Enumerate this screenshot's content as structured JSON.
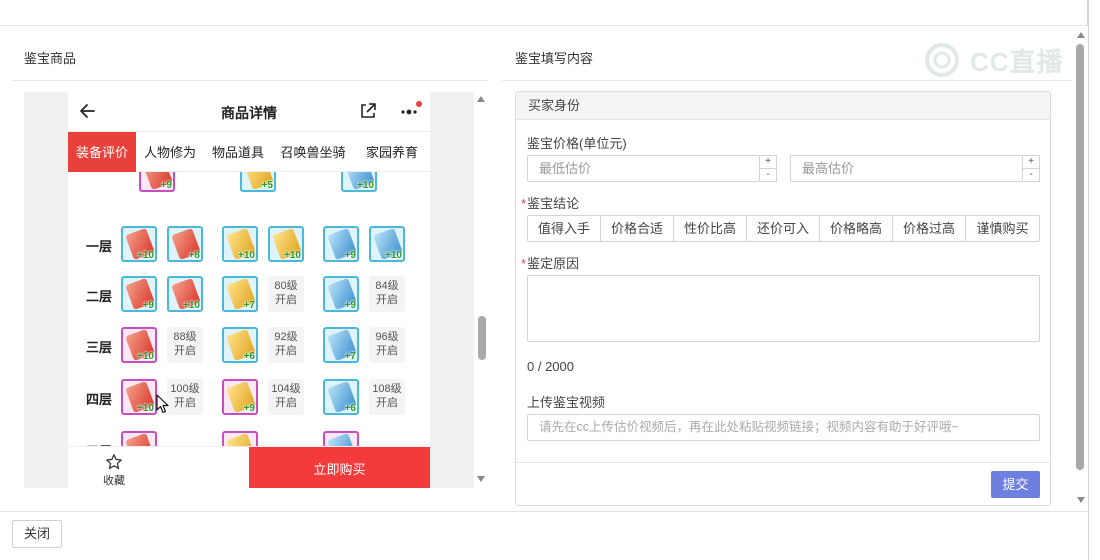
{
  "left_panel": {
    "title": "鉴宝商品",
    "phone": {
      "title": "商品详情",
      "tabs": [
        {
          "label": "装备评价",
          "active": true
        },
        {
          "label": "人物修为",
          "active": false
        },
        {
          "label": "物品道具",
          "active": false
        },
        {
          "label": "召唤兽坐骑",
          "active": false
        },
        {
          "label": "家园养育",
          "active": false
        }
      ],
      "top_row_levels": [
        "+9",
        "+5",
        "+10"
      ],
      "floors": [
        {
          "label": "一层",
          "slots": [
            {
              "type": "item",
              "color": "red",
              "level": "+10"
            },
            {
              "type": "item",
              "color": "red",
              "level": "+8"
            },
            {
              "type": "item",
              "color": "gold",
              "level": "+10"
            },
            {
              "type": "item",
              "color": "gold",
              "level": "+10"
            },
            {
              "type": "item",
              "color": "blue",
              "level": "+9"
            },
            {
              "type": "item",
              "color": "blue",
              "level": "+10"
            }
          ]
        },
        {
          "label": "二层",
          "slots": [
            {
              "type": "item",
              "color": "red",
              "level": "+9"
            },
            {
              "type": "item",
              "color": "red",
              "level": "+10"
            },
            {
              "type": "item",
              "color": "gold",
              "level": "+7"
            },
            {
              "type": "locked",
              "line1": "80级",
              "line2": "开启"
            },
            {
              "type": "item",
              "color": "blue",
              "level": "+9"
            },
            {
              "type": "locked",
              "line1": "84级",
              "line2": "开启"
            }
          ]
        },
        {
          "label": "三层",
          "slots": [
            {
              "type": "item",
              "color": "red",
              "level": "+10",
              "purple": true
            },
            {
              "type": "locked",
              "line1": "88级",
              "line2": "开启"
            },
            {
              "type": "item",
              "color": "gold",
              "level": "+6"
            },
            {
              "type": "locked",
              "line1": "92级",
              "line2": "开启"
            },
            {
              "type": "item",
              "color": "blue",
              "level": "+7"
            },
            {
              "type": "locked",
              "line1": "96级",
              "line2": "开启"
            }
          ]
        },
        {
          "label": "四层",
          "slots": [
            {
              "type": "item",
              "color": "red",
              "level": "+10",
              "purple": true
            },
            {
              "type": "locked",
              "line1": "100级",
              "line2": "开启"
            },
            {
              "type": "item",
              "color": "gold",
              "level": "+9",
              "purple": true
            },
            {
              "type": "locked",
              "line1": "104级",
              "line2": "开启"
            },
            {
              "type": "item",
              "color": "blue",
              "level": "+6"
            },
            {
              "type": "locked",
              "line1": "108级",
              "line2": "开启"
            }
          ]
        },
        {
          "label": "五层",
          "slots": [
            {
              "type": "item",
              "color": "red",
              "level": "",
              "purple": true
            },
            {
              "type": "empty"
            },
            {
              "type": "item",
              "color": "gold",
              "level": "",
              "purple": true
            },
            {
              "type": "empty"
            },
            {
              "type": "item",
              "color": "blue",
              "level": "",
              "purple": true
            },
            {
              "type": "empty"
            }
          ]
        }
      ],
      "favorite_label": "收藏",
      "buy_label": "立即购买"
    }
  },
  "right_panel": {
    "title": "鉴宝填写内容",
    "watermark": "CC直播",
    "section_title": "买家身份",
    "price_label": "鉴宝价格(单位元)",
    "min_price_placeholder": "最低估价",
    "max_price_placeholder": "最高估价",
    "stepper_plus": "+",
    "stepper_minus": "-",
    "conclusion_label": "鉴宝结论",
    "conclusion_options": [
      "值得入手",
      "价格合适",
      "性价比高",
      "还价可入",
      "价格略高",
      "价格过高",
      "谨慎购买"
    ],
    "reason_label": "鉴定原因",
    "char_count": "0 / 2000",
    "video_label": "上传鉴宝视频",
    "video_placeholder": "请先在cc上传估价视频后，再在此处粘贴视频链接；视频内容有助于好评哦~",
    "submit_label": "提交"
  },
  "footer": {
    "close_label": "关闭"
  },
  "colors": {
    "accent_red": "#e8403a",
    "buy_red": "#f33b3b",
    "submit_blue": "#6f7fe0",
    "required_star": "#e5484d"
  }
}
